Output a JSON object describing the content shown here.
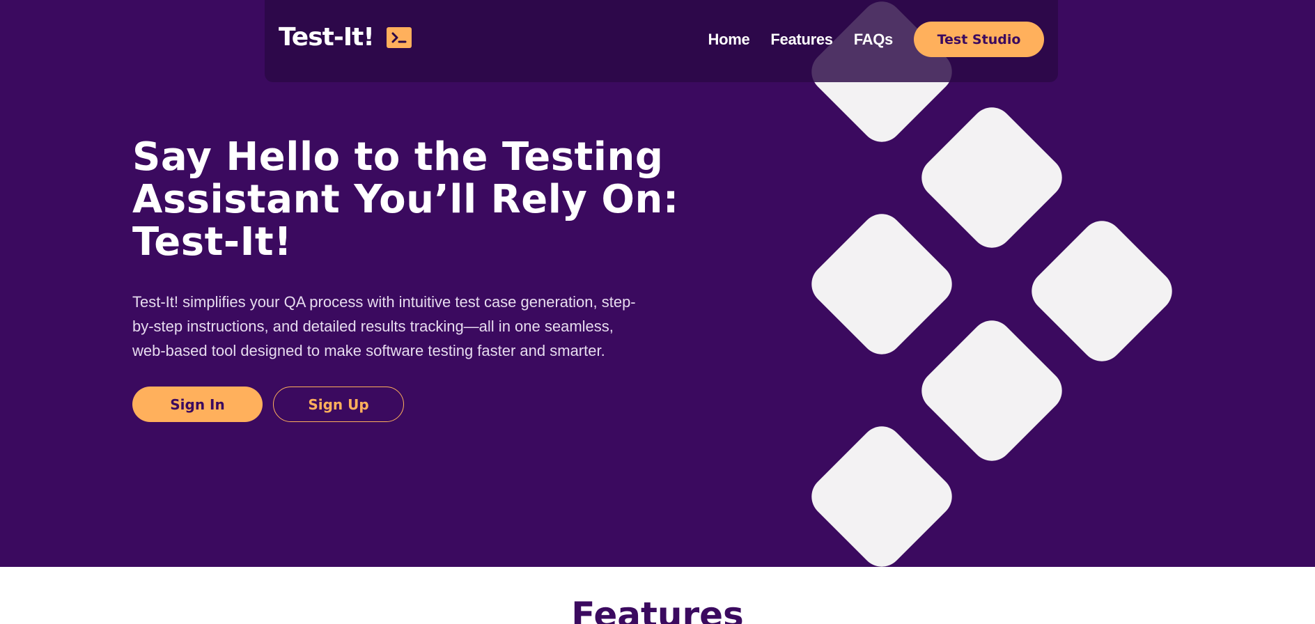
{
  "brand": {
    "name": "Test-It!",
    "icon": "terminal-icon"
  },
  "nav": {
    "items": [
      {
        "label": "Home"
      },
      {
        "label": "Features"
      },
      {
        "label": "FAQs"
      }
    ],
    "cta_label": "Test Studio"
  },
  "hero": {
    "headline": "Say Hello to the Testing\nAssistant You’ll Rely On:\nTest-It!",
    "subtext": "Test-It! simplifies your QA process with intuitive test case generation, step-\nby-step instructions, and detailed results tracking—all in one seamless,\nweb-based tool designed to make software testing faster and smarter.",
    "signin_label": "Sign In",
    "signup_label": "Sign Up"
  },
  "features": {
    "title": "Features"
  },
  "colors": {
    "primary": "#3b0a5f",
    "accent": "#ffb05c",
    "tile": "#f3f2f3"
  }
}
